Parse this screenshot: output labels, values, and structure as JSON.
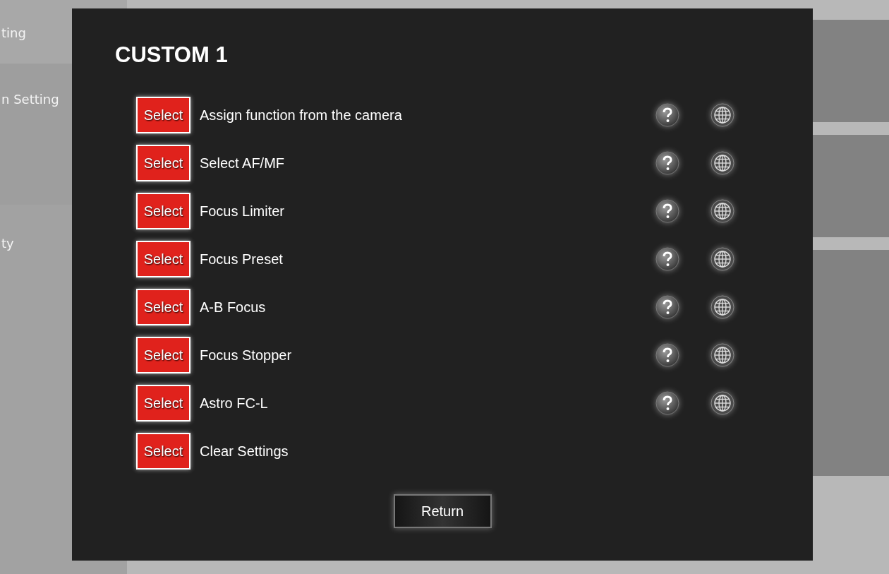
{
  "background": {
    "sidebar_items": [
      "ting",
      "n Setting",
      "ty"
    ]
  },
  "dialog": {
    "title": "CUSTOM 1",
    "rows": [
      {
        "button": "Select",
        "label": "Assign function from the camera",
        "kind": "function"
      },
      {
        "button": "Select",
        "label": "Select AF/MF",
        "kind": "function"
      },
      {
        "button": "Select",
        "label": "Focus Limiter",
        "kind": "function"
      },
      {
        "button": "Select",
        "label": "Focus Preset",
        "kind": "function"
      },
      {
        "button": "Select",
        "label": "A-B Focus",
        "kind": "function"
      },
      {
        "button": "Select",
        "label": "Focus Stopper",
        "kind": "function"
      },
      {
        "button": "Select",
        "label": "Astro FC-L",
        "kind": "function"
      },
      {
        "button": "Select",
        "label": "Clear Settings",
        "kind": "action"
      }
    ],
    "return_button": "Return"
  }
}
